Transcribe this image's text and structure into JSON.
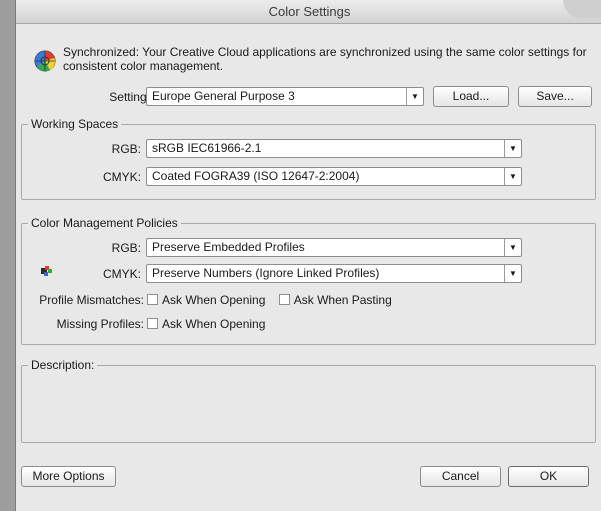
{
  "window": {
    "title": "Color Settings"
  },
  "sync": {
    "message": "Synchronized: Your Creative Cloud applications are synchronized using the same color settings for consistent color management."
  },
  "settings": {
    "label": "Settings:",
    "value": "Europe General Purpose 3",
    "load_label": "Load...",
    "save_label": "Save..."
  },
  "working_spaces": {
    "title": "Working Spaces",
    "rgb_label": "RGB:",
    "rgb_value": "sRGB IEC61966-2.1",
    "cmyk_label": "CMYK:",
    "cmyk_value": "Coated FOGRA39 (ISO 12647-2:2004)"
  },
  "policies": {
    "title": "Color Management Policies",
    "rgb_label": "RGB:",
    "rgb_value": "Preserve Embedded Profiles",
    "cmyk_label": "CMYK:",
    "cmyk_value": "Preserve Numbers (Ignore Linked Profiles)",
    "mismatch_label": "Profile Mismatches:",
    "ask_opening": "Ask When Opening",
    "ask_pasting": "Ask When Pasting",
    "missing_label": "Missing Profiles:",
    "missing_ask_opening": "Ask When Opening"
  },
  "description": {
    "title": "Description:"
  },
  "footer": {
    "more_options": "More Options",
    "cancel": "Cancel",
    "ok": "OK"
  },
  "colors": {
    "window_bg": "#e8e8e8",
    "desktop_bg": "#9d9d9d"
  }
}
